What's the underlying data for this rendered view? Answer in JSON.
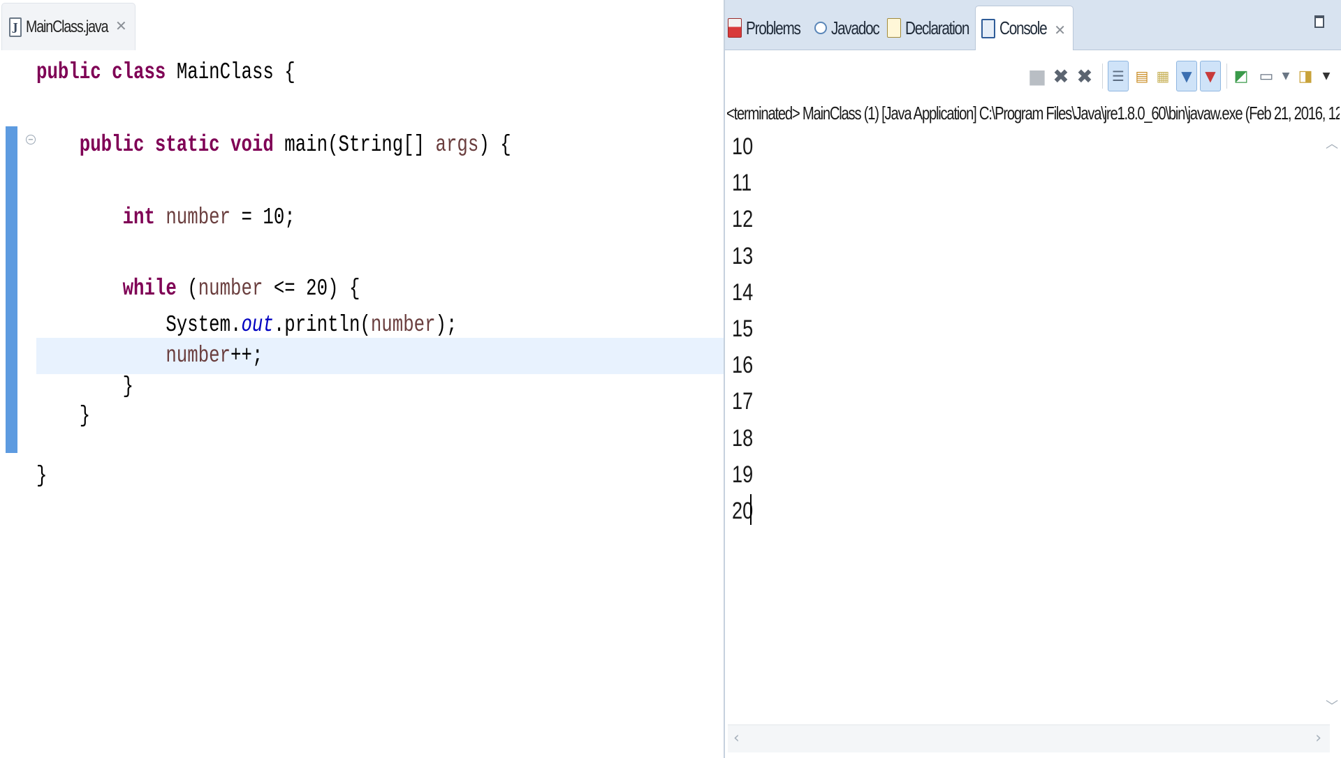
{
  "editor": {
    "tab": {
      "label": "MainClass.java",
      "icon": "java-file-icon"
    },
    "code_lines": [
      [
        {
          "t": "public class ",
          "c": "kw"
        },
        {
          "t": "MainClass {",
          "c": "pl"
        }
      ],
      [],
      [
        {
          "t": "    public static void ",
          "c": "kw"
        },
        {
          "t": "main(String[] ",
          "c": "pl"
        },
        {
          "t": "args",
          "c": "var"
        },
        {
          "t": ") {",
          "c": "pl"
        }
      ],
      [],
      [
        {
          "t": "        int ",
          "c": "kw"
        },
        {
          "t": "number",
          "c": "var"
        },
        {
          "t": " = 10;",
          "c": "pl"
        }
      ],
      [],
      [
        {
          "t": "        while ",
          "c": "kw"
        },
        {
          "t": "(",
          "c": "pl"
        },
        {
          "t": "number",
          "c": "var"
        },
        {
          "t": " <= 20) {",
          "c": "pl"
        }
      ],
      [
        {
          "t": "            System.",
          "c": "pl"
        },
        {
          "t": "out",
          "c": "fld"
        },
        {
          "t": ".println(",
          "c": "pl"
        },
        {
          "t": "number",
          "c": "var"
        },
        {
          "t": ");",
          "c": "pl"
        }
      ],
      [
        {
          "t": "            ",
          "c": "pl"
        },
        {
          "t": "number",
          "c": "var"
        },
        {
          "t": "++;",
          "c": "pl"
        }
      ],
      [
        {
          "t": "        }",
          "c": "pl"
        }
      ],
      [
        {
          "t": "    }",
          "c": "pl"
        }
      ],
      [],
      [
        {
          "t": "}",
          "c": "pl"
        }
      ]
    ],
    "current_line_index": 8
  },
  "console_view": {
    "tabs": [
      {
        "label": "Problems",
        "icon": "problems-icon"
      },
      {
        "label": "Javadoc",
        "icon": "javadoc-icon"
      },
      {
        "label": "Declaration",
        "icon": "declaration-icon"
      },
      {
        "label": "Console",
        "icon": "console-icon",
        "active": true
      }
    ],
    "toolbar": [
      "terminate-icon",
      "remove-launch-icon",
      "remove-all-terminated-icon",
      "scroll-lock-icon",
      "word-wrap-icon",
      "show-on-output-icon",
      "show-on-stdout-icon",
      "show-on-stderr-icon",
      "pin-console-icon",
      "display-console-icon",
      "open-console-icon"
    ],
    "process_label": "<terminated> MainClass (1) [Java Application] C:\\Program Files\\Java\\jre1.8.0_60\\bin\\javaw.exe (Feb 21, 2016, 12:",
    "output_lines": [
      "10",
      "11",
      "12",
      "13",
      "14",
      "15",
      "16",
      "17",
      "18",
      "19",
      "20"
    ]
  },
  "colors": {
    "keyword": "#7f0055",
    "variable": "#6a3e3e",
    "static_field": "#0000c0",
    "current_line": "#e8f2fe",
    "change_bar": "#5d9be0",
    "view_tabbar": "#d8e3f0"
  }
}
